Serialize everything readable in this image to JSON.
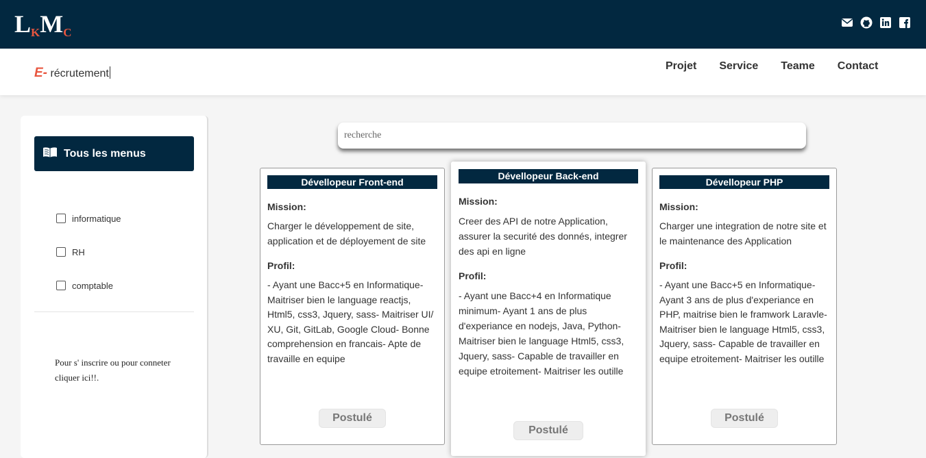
{
  "logo": {
    "l": "L",
    "k": "K",
    "m": "M",
    "c": "C"
  },
  "social_icons": [
    "mail-icon",
    "github-icon",
    "linkedin-icon",
    "facebook-icon"
  ],
  "brand": {
    "prefix": "E-",
    "text": " récrutement"
  },
  "nav": {
    "projet": "Projet",
    "service": "Service",
    "teame": "Teame",
    "contact": "Contact"
  },
  "sidebar": {
    "header_icon": "book-icon",
    "header": "Tous les menus",
    "categories": [
      "informatique",
      "RH",
      "comptable"
    ],
    "login_text": "Pour s' inscrire ou pour conneter cliquer ici!!."
  },
  "search": {
    "placeholder": "recherche"
  },
  "jobs": [
    {
      "title": "Dévellopeur Front-end",
      "mission_label": "Mission:",
      "mission": "Charger le développement de site, application et de déployement de site",
      "profil_label": "Profil:",
      "profil": "- Ayant une Bacc+5 en Informatique- Maitriser bien le language reactjs, Html5, css3, Jquery, sass- Maitriser UI/ XU, Git, GitLab, Google Cloud- Bonne comprehension en francais- Apte de travaille en equipe",
      "button": "Postulé"
    },
    {
      "title": "Dévellopeur Back-end",
      "mission_label": "Mission:",
      "mission": "Creer des API de notre Application, assurer la securité des donnés, integrer des api en ligne",
      "profil_label": "Profil:",
      "profil": "- Ayant une Bacc+4 en Informatique minimum- Ayant 1 ans de plus d'experiance en nodejs, Java, Python- Maitriser bien le language Html5, css3, Jquery, sass- Capable de travailler en equipe etroitement- Maitriser les outille",
      "button": "Postulé"
    },
    {
      "title": "Dévellopeur PHP",
      "mission_label": "Mission:",
      "mission": "Charger une integration de notre site et le maintenance des Application",
      "profil_label": "Profil:",
      "profil": "- Ayant une Bacc+5 en Informatique- Ayant 3 ans de plus d'experiance en PHP, maitrise bien le framwork Laravle- Maitriser bien le language Html5, css3, Jquery, sass- Capable de travailler en equipe etroitement- Maitriser les outille",
      "button": "Postulé"
    }
  ],
  "colors": {
    "primary": "#022840",
    "accent": "#e8563f",
    "background": "#f5f5f5"
  }
}
